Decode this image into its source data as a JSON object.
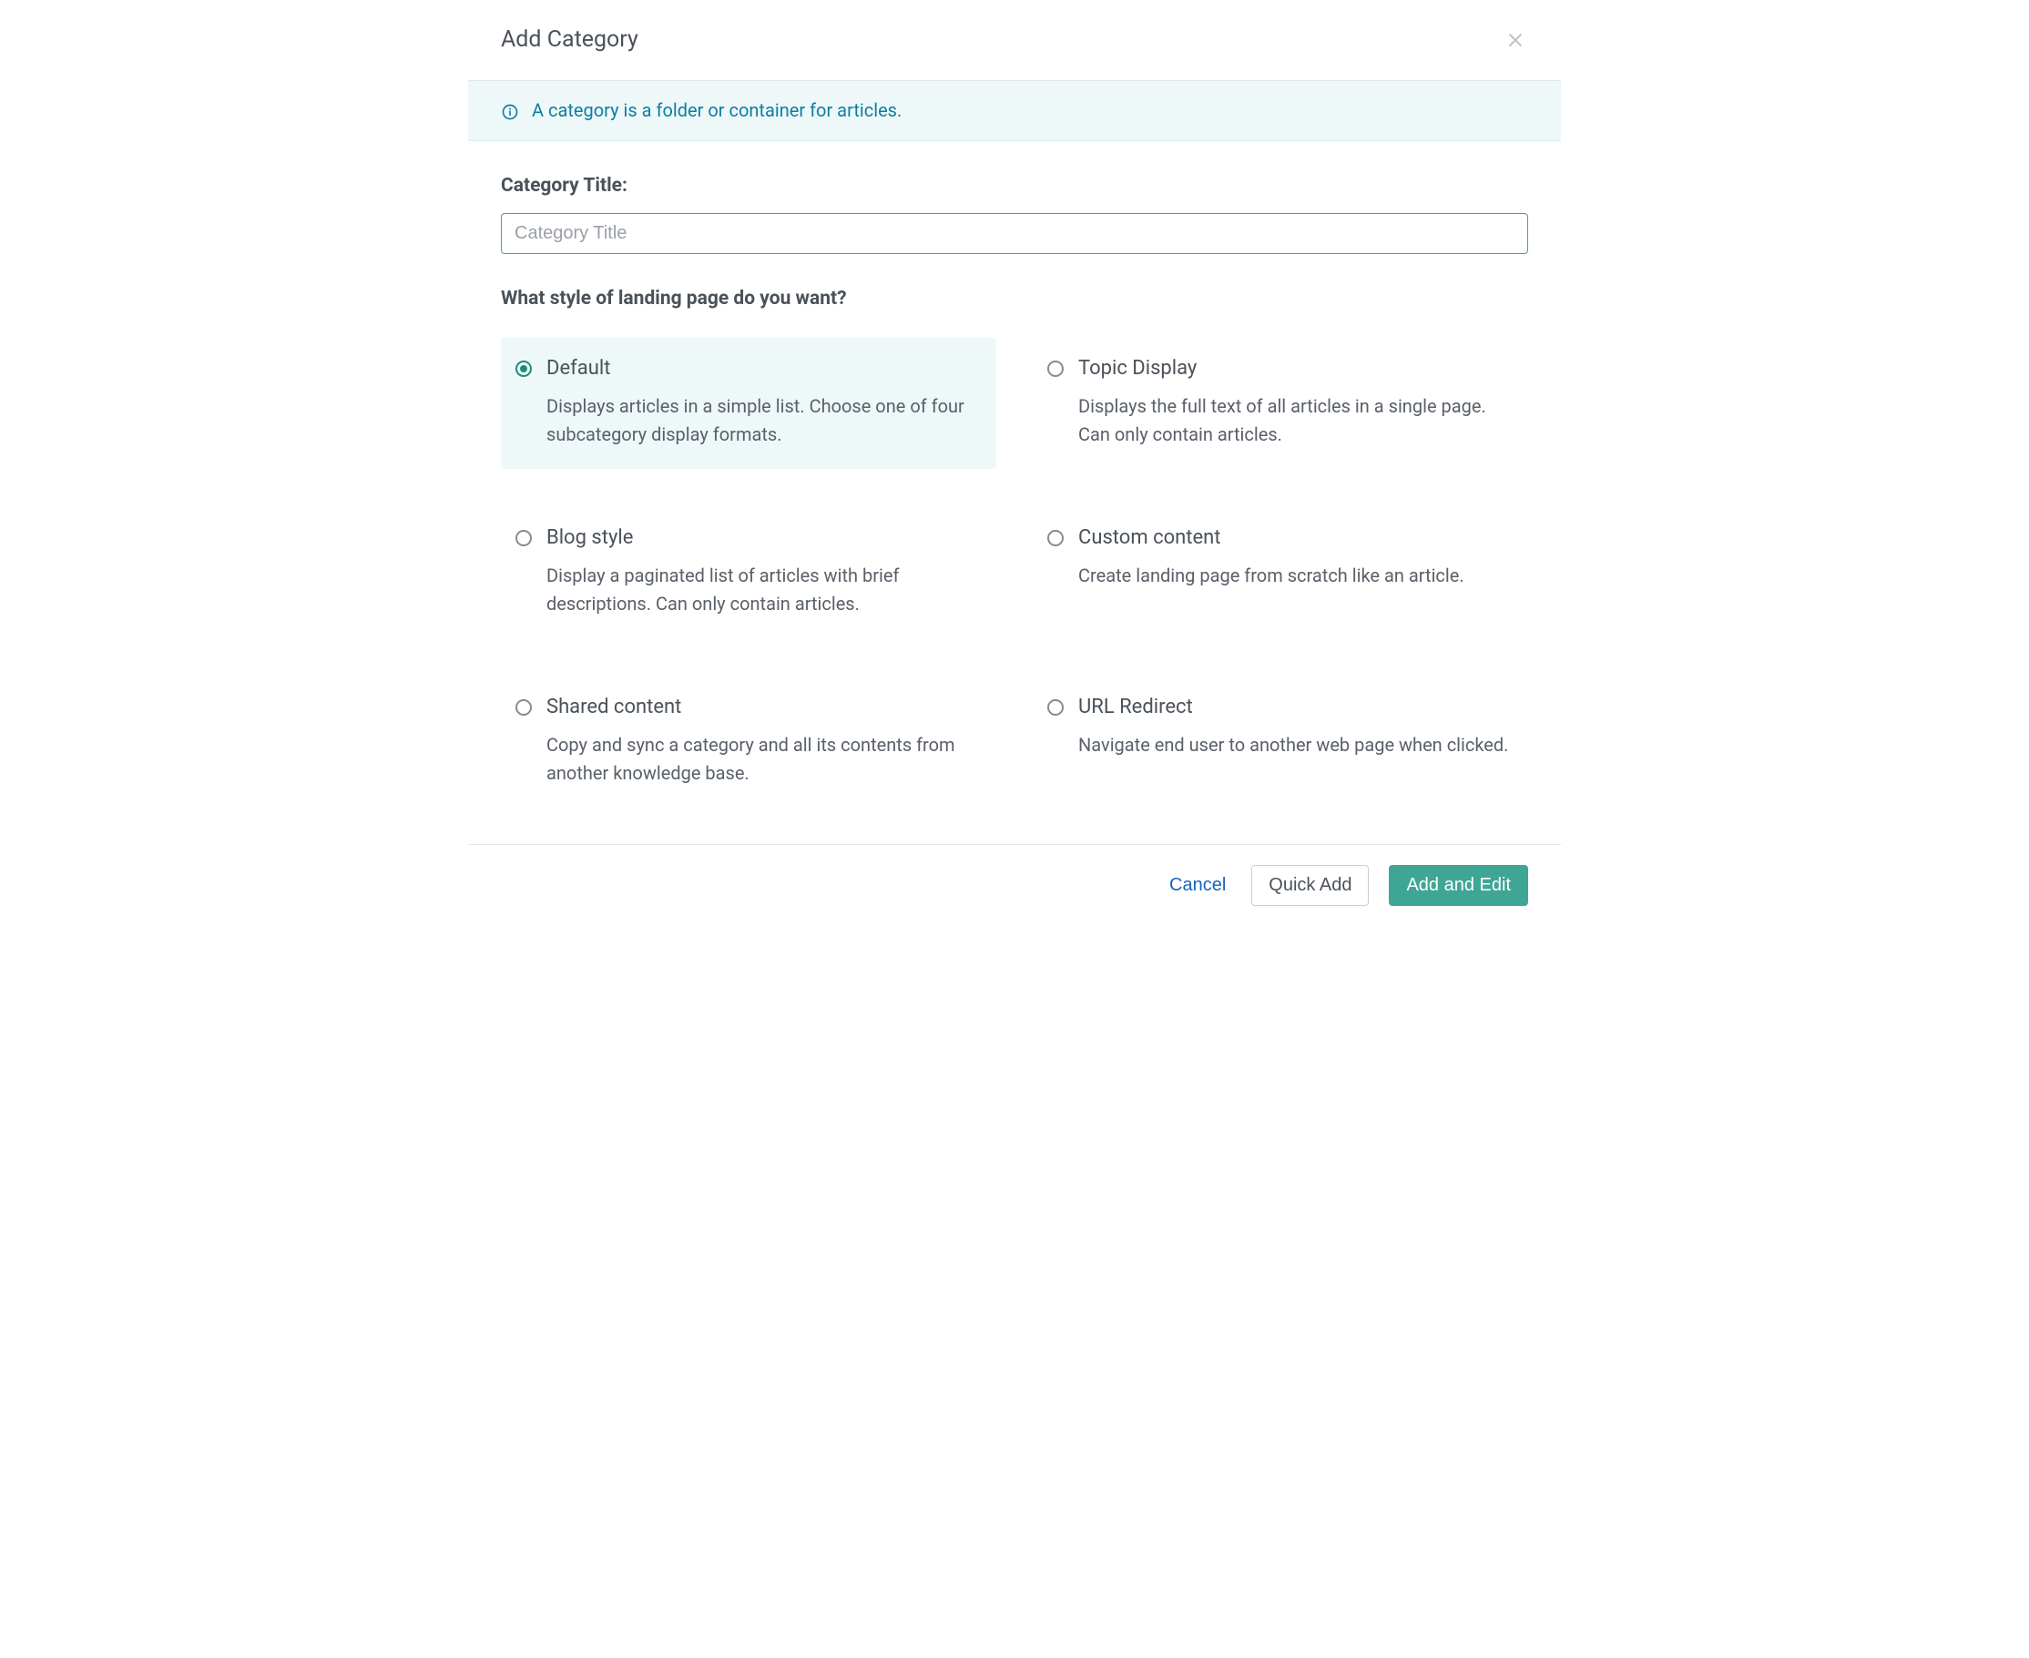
{
  "header": {
    "title": "Add Category"
  },
  "info": {
    "text": "A category is a folder or container for articles."
  },
  "form": {
    "title_label": "Category Title:",
    "title_placeholder": "Category Title",
    "title_value": "",
    "style_heading": "What style of landing page do you want?",
    "options": [
      {
        "id": "default",
        "title": "Default",
        "desc": "Displays articles in a simple list. Choose one of four subcategory display formats.",
        "selected": true
      },
      {
        "id": "topic-display",
        "title": "Topic Display",
        "desc": "Displays the full text of all articles in a single page. Can only contain articles.",
        "selected": false
      },
      {
        "id": "blog-style",
        "title": "Blog style",
        "desc": "Display a paginated list of articles with brief descriptions. Can only contain articles.",
        "selected": false
      },
      {
        "id": "custom-content",
        "title": "Custom content",
        "desc": "Create landing page from scratch like an article.",
        "selected": false
      },
      {
        "id": "shared-content",
        "title": "Shared content",
        "desc": "Copy and sync a category and all its contents from another knowledge base.",
        "selected": false
      },
      {
        "id": "url-redirect",
        "title": "URL Redirect",
        "desc": "Navigate end user to another web page when clicked.",
        "selected": false
      }
    ]
  },
  "footer": {
    "cancel": "Cancel",
    "quick_add": "Quick Add",
    "add_edit": "Add and Edit"
  }
}
